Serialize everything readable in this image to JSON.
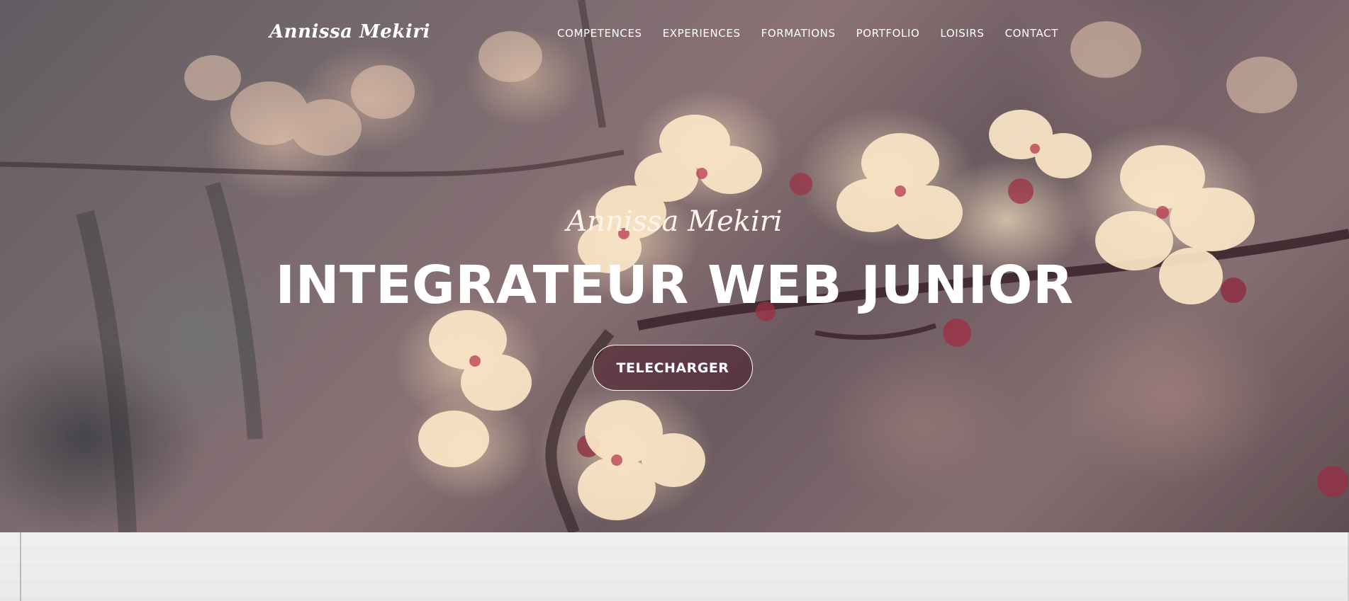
{
  "nav": {
    "logo": "Annissa Mekiri",
    "items": [
      {
        "label": "COMPETENCES"
      },
      {
        "label": "EXPERIENCES"
      },
      {
        "label": "FORMATIONS"
      },
      {
        "label": "PORTFOLIO"
      },
      {
        "label": "LOISIRS"
      },
      {
        "label": "CONTACT"
      }
    ]
  },
  "hero": {
    "subtitle": "Annissa Mekiri",
    "title": "INTEGRATEUR WEB JUNIOR",
    "button_label": "TELECHARGER",
    "background": "cherry-blossom-photo"
  },
  "colors": {
    "button_fill": "#4b1928",
    "text": "#ffffff",
    "floor": "#ececea"
  }
}
